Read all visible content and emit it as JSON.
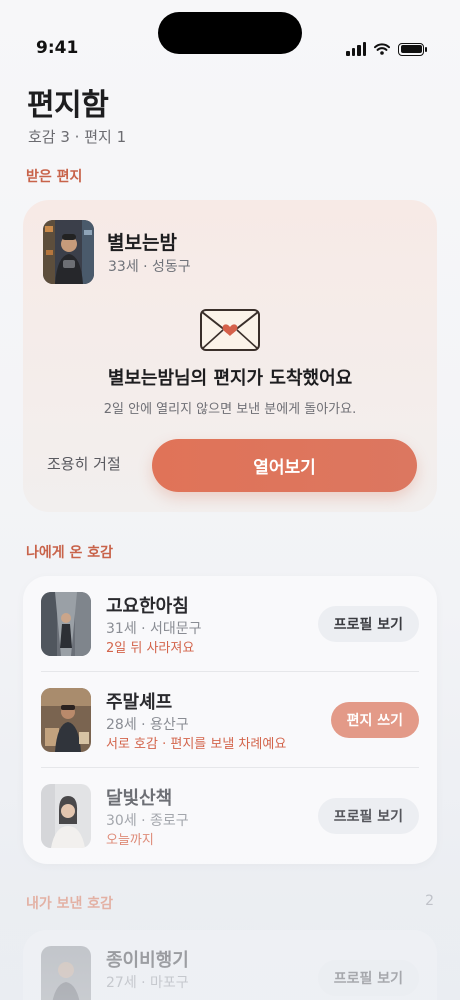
{
  "status_bar": {
    "time": "9:41"
  },
  "header": {
    "title": "편지함",
    "subtitle": "호감 3 · 편지 1"
  },
  "received_letter": {
    "section_label": "받은 편지",
    "sender_name": "별보는밤",
    "sender_meta": "33세 · 성동구",
    "title": "별보는밤님의 편지가 도착했어요",
    "note": "2일 안에 열리지 않으면 보낸 분에게 돌아가요.",
    "decline_label": "조용히 거절",
    "open_label": "열어보기"
  },
  "likes_received": {
    "section_label": "나에게 온 호감",
    "items": [
      {
        "name": "고요한아침",
        "meta": "31세 · 서대문구",
        "status": "2일 뒤 사라져요",
        "button": "프로필 보기"
      },
      {
        "name": "주말셰프",
        "meta": "28세 · 용산구",
        "status": "서로 호감 · 편지를 보낼 차례예요",
        "button": "편지 쓰기"
      },
      {
        "name": "달빛산책",
        "meta": "30세 · 종로구",
        "status": "오늘까지",
        "button": "프로필 보기"
      }
    ]
  },
  "likes_sent": {
    "section_label": "내가 보낸 호감",
    "count": "2",
    "items": [
      {
        "name": "종이비행기",
        "meta": "27세 · 마포구",
        "button": "프로필 보기"
      }
    ]
  },
  "colors": {
    "accent": "#e07358",
    "accent_soft": "#e39a88",
    "label": "#c8634a"
  },
  "icons": {
    "envelope": "envelope-heart-icon",
    "signal": "signal-icon",
    "wifi": "wifi-icon",
    "battery": "battery-icon"
  }
}
